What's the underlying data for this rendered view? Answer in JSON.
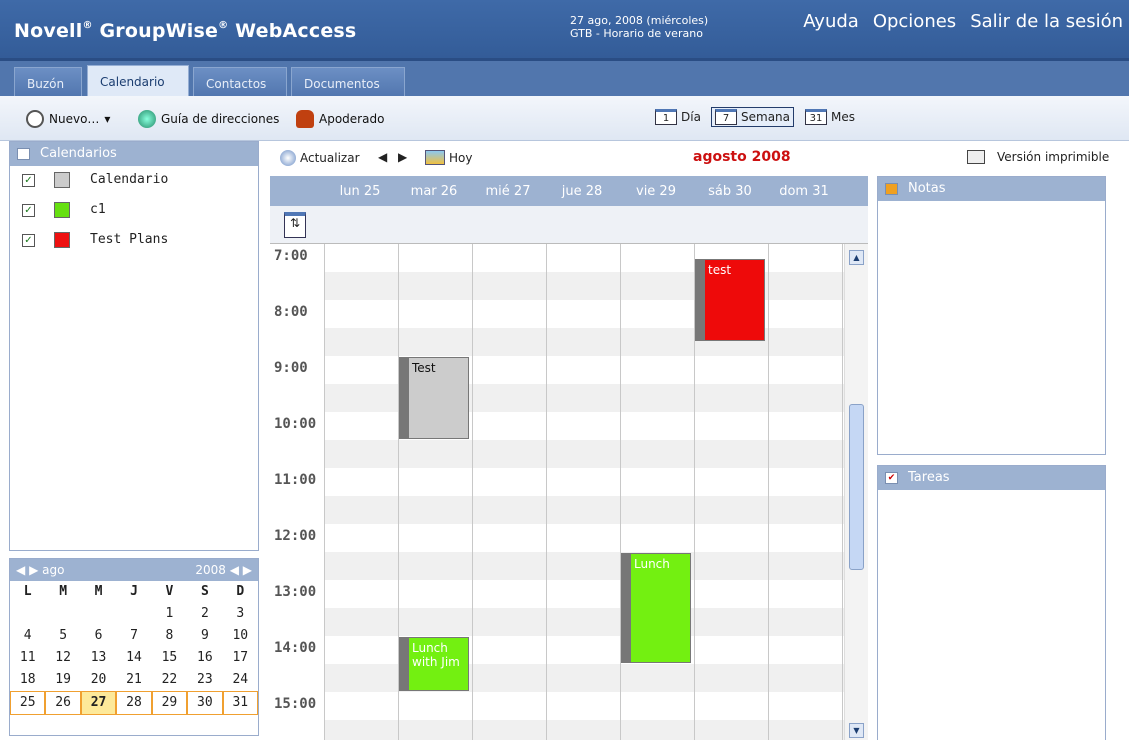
{
  "header": {
    "brand_novell": "Novell",
    "brand_gw": "GroupWise",
    "brand_wa": "WebAccess",
    "reg": "®",
    "date_line1": "27 ago, 2008 (miércoles)",
    "date_line2": "GTB - Horario de verano",
    "links": [
      "Ayuda",
      "Opciones",
      "Salir de la sesión"
    ]
  },
  "tabs": [
    "Buzón",
    "Calendario",
    "Contactos",
    "Documentos"
  ],
  "toolbar": {
    "new": "Nuevo…",
    "addressbook": "Guía de direcciones",
    "proxy": "Apoderado",
    "views": [
      {
        "num": "1",
        "label": "Día"
      },
      {
        "num": "7",
        "label": "Semana"
      },
      {
        "num": "31",
        "label": "Mes"
      }
    ]
  },
  "calendars": {
    "title": "Calendarios",
    "items": [
      {
        "name": "Calendario",
        "color": "#cccccc"
      },
      {
        "name": "c1",
        "color": "#66e010"
      },
      {
        "name": "Test Plans",
        "color": "#ee1010"
      }
    ]
  },
  "minical": {
    "month": "ago",
    "year": "2008",
    "daynames": [
      "L",
      "M",
      "M",
      "J",
      "V",
      "S",
      "D"
    ],
    "weeks": [
      [
        "",
        "",
        "",
        "",
        "1",
        "2",
        "3"
      ],
      [
        "4",
        "5",
        "6",
        "7",
        "8",
        "9",
        "10"
      ],
      [
        "11",
        "12",
        "13",
        "14",
        "15",
        "16",
        "17"
      ],
      [
        "18",
        "19",
        "20",
        "21",
        "22",
        "23",
        "24"
      ],
      [
        "25",
        "26",
        "27",
        "28",
        "29",
        "30",
        "31"
      ]
    ],
    "today": "27"
  },
  "week": {
    "refresh": "Actualizar",
    "today": "Hoy",
    "month_title": "agosto 2008",
    "print": "Versión imprimible",
    "days": [
      "lun 25",
      "mar 26",
      "mié 27",
      "jue 28",
      "vie 29",
      "sáb 30",
      "dom 31"
    ],
    "hours": [
      "7:00",
      "8:00",
      "9:00",
      "10:00",
      "11:00",
      "12:00",
      "13:00",
      "14:00",
      "15:00"
    ]
  },
  "events": [
    {
      "title": "test",
      "day": 5,
      "start": "7:15",
      "end": "8:45",
      "bg": "#ee0a0a",
      "fg": "#ffffff"
    },
    {
      "title": "Test",
      "day": 1,
      "start": "9:00",
      "end": "10:30",
      "bg": "#cccccc",
      "fg": "#111111"
    },
    {
      "title": "Lunch",
      "day": 4,
      "start": "12:30",
      "end": "14:30",
      "bg": "#73f011",
      "fg": "#ffffff"
    },
    {
      "title": "Lunch with Jim",
      "day": 1,
      "start": "14:00",
      "end": "15:00",
      "bg": "#73f011",
      "fg": "#ffffff"
    }
  ],
  "notes": {
    "title": "Notas"
  },
  "tasks": {
    "title": "Tareas"
  }
}
